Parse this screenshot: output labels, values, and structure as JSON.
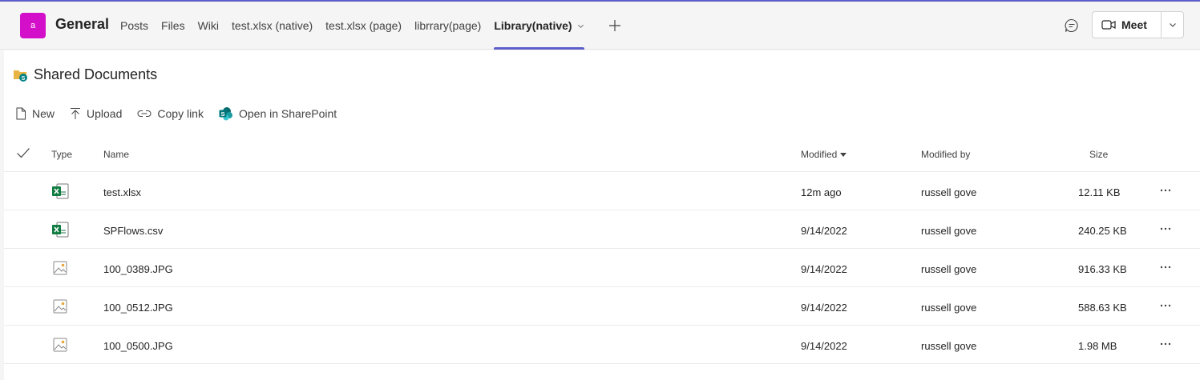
{
  "accent": "#5b5fc7",
  "team": {
    "avatar_letter": "a",
    "avatar_color": "#d40fca"
  },
  "channel": {
    "title": "General"
  },
  "tabs": [
    {
      "label": "Posts",
      "active": false
    },
    {
      "label": "Files",
      "active": false
    },
    {
      "label": "Wiki",
      "active": false
    },
    {
      "label": "test.xlsx (native)",
      "active": false
    },
    {
      "label": "test.xlsx (page)",
      "active": false
    },
    {
      "label": "librrary(page)",
      "active": false
    },
    {
      "label": "Library(native)",
      "active": true
    }
  ],
  "header_actions": {
    "meet_label": "Meet",
    "chat_icon": "chat-icon",
    "camera_icon": "video-camera-icon"
  },
  "library": {
    "title": "Shared Documents"
  },
  "commands": {
    "new": "New",
    "upload": "Upload",
    "copy_link": "Copy link",
    "open_sharepoint": "Open in SharePoint"
  },
  "columns": {
    "type": "Type",
    "name": "Name",
    "modified": "Modified",
    "modified_by": "Modified by",
    "size": "Size"
  },
  "files": [
    {
      "type": "excel",
      "name": "test.xlsx",
      "modified": "12m ago",
      "modified_by": "russell gove",
      "size": "12.11 KB"
    },
    {
      "type": "excel",
      "name": "SPFlows.csv",
      "modified": "9/14/2022",
      "modified_by": "russell gove",
      "size": "240.25 KB"
    },
    {
      "type": "image",
      "name": "100_0389.JPG",
      "modified": "9/14/2022",
      "modified_by": "russell gove",
      "size": "916.33 KB"
    },
    {
      "type": "image",
      "name": "100_0512.JPG",
      "modified": "9/14/2022",
      "modified_by": "russell gove",
      "size": "588.63 KB"
    },
    {
      "type": "image",
      "name": "100_0500.JPG",
      "modified": "9/14/2022",
      "modified_by": "russell gove",
      "size": "1.98 MB"
    }
  ]
}
